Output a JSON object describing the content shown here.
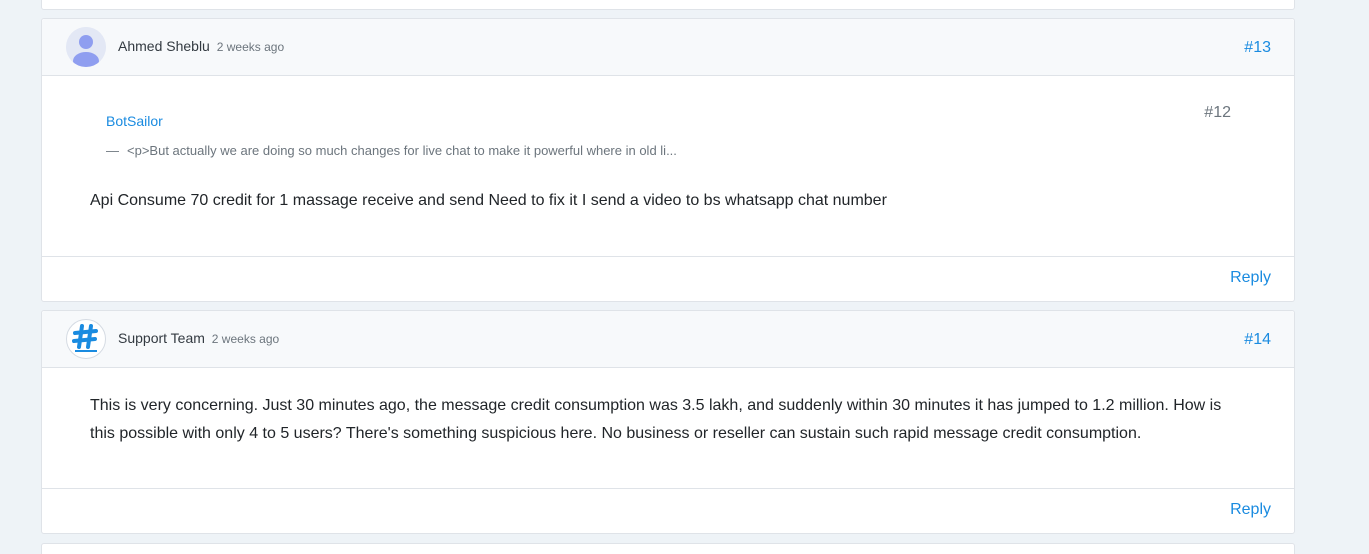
{
  "posts": [
    {
      "author": "Ahmed Sheblu",
      "time": "2 weeks ago",
      "number": "#13",
      "quote": {
        "author": "BotSailor",
        "number": "#12",
        "dash": "—",
        "excerpt": "<p>But actually we are doing so much changes for live chat to make it powerful where in old li..."
      },
      "text": "Api Consume 70 credit for 1 massage receive and send Need to fix it I send a video to bs whatsapp chat number",
      "reply_label": "Reply"
    },
    {
      "author": "Support Team",
      "time": "2 weeks ago",
      "number": "#14",
      "text": "This is very concerning. Just 30 minutes ago, the message credit consumption was 3.5 lakh, and suddenly within 30 minutes it has jumped to 1.2 million. How is this possible with only 4 to 5 users? There's something suspicious here. No business or reseller can sustain such rapid message credit consumption.",
      "reply_label": "Reply"
    }
  ],
  "colors": {
    "link": "#1a8be0",
    "page_bg": "#eef3f7",
    "brand_icon": "#1a8be0"
  },
  "icons": {
    "default_avatar": "user-silhouette-icon",
    "brand_avatar": "hashtag-logo-icon"
  }
}
